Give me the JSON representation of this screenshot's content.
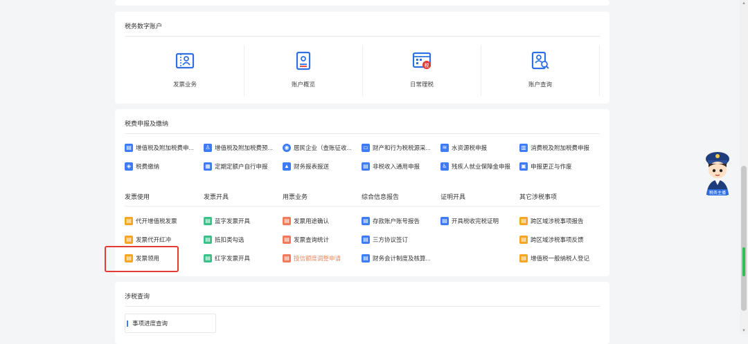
{
  "section1": {
    "title": "税务数字账户",
    "tiles": [
      {
        "label": "发票业务",
        "icon": "invoice-business-icon"
      },
      {
        "label": "账户概览",
        "icon": "account-overview-icon"
      },
      {
        "label": "日常理税",
        "icon": "daily-tax-icon"
      },
      {
        "label": "账户查询",
        "icon": "account-query-icon"
      }
    ]
  },
  "section2": {
    "title": "税费申报及缴纳",
    "declarations": [
      {
        "label": "增值税及附加税费申...",
        "color": "#3d7bf7",
        "icon": "declaration-icon"
      },
      {
        "label": "增值税及附加税费预...",
        "color": "#3d7bf7",
        "icon": "declaration-icon"
      },
      {
        "label": "居民企业（查账征收...",
        "color": "#3d7bf7",
        "icon": "enterprise-icon"
      },
      {
        "label": "财产和行为税税源采...",
        "color": "#3d7bf7",
        "icon": "property-icon"
      },
      {
        "label": "水资源税申报",
        "color": "#3d7bf7",
        "icon": "water-icon"
      },
      {
        "label": "消费税及附加税费申报",
        "color": "#3d7bf7",
        "icon": "consumption-icon"
      },
      {
        "label": "税费缴纳",
        "color": "#3d7bf7",
        "icon": "payment-icon"
      },
      {
        "label": "定期定额户自行申报",
        "color": "#3d7bf7",
        "icon": "fixed-quota-icon"
      },
      {
        "label": "财务报表报送",
        "color": "#3d7bf7",
        "icon": "report-icon"
      },
      {
        "label": "非税收入通用申报",
        "color": "#3d7bf7",
        "icon": "non-tax-icon"
      },
      {
        "label": "残疾人就业保障金申报",
        "color": "#3d7bf7",
        "icon": "disability-icon"
      },
      {
        "label": "申报更正与作废",
        "color": "#3d7bf7",
        "icon": "correction-icon"
      }
    ],
    "categories": [
      "发票使用",
      "发票开具",
      "用票业务",
      "综合信息报告",
      "证明开具",
      "其它涉税事项"
    ],
    "columns": [
      {
        "color": "#f5a623",
        "items": [
          "代开增值税发票",
          "发票代开红冲",
          "发票领用"
        ]
      },
      {
        "color": "#3cc08a",
        "items": [
          "蓝字发票开具",
          "抵扣类勾选",
          "红字发票开具"
        ]
      },
      {
        "color": "#f07a5a",
        "items": [
          "发票用途确认",
          "发票查询统计",
          "授信额度调整申请"
        ]
      },
      {
        "color": "#3d7bf7",
        "items": [
          "存款账户账号报告",
          "三方协议签订",
          "财务会计制度及核算..."
        ]
      },
      {
        "color": "#3d7bf7",
        "items": [
          "开具税收完税证明"
        ]
      },
      {
        "color": "#f5a623",
        "items": [
          "跨区域涉税事项报告",
          "跨区域涉税事项反馈",
          "增值税一般纳税人登记"
        ]
      }
    ]
  },
  "section3": {
    "title": "涉税查询",
    "query": "事项进度查询"
  },
  "mascot": {
    "caption": "税务主播",
    "icon": "tax-officer-mascot-icon"
  }
}
